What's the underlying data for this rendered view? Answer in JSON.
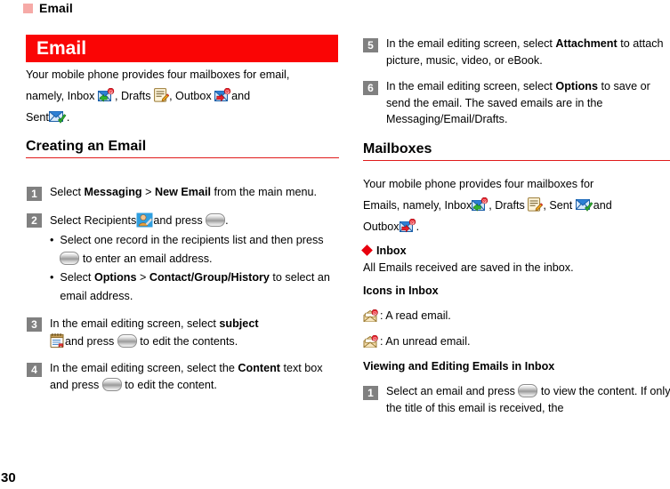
{
  "running_header": {
    "title": "Email",
    "marker_color": "#f6aaa7"
  },
  "title_bar": {
    "label": "Email",
    "bg": "#fa0505",
    "fg": "#ffffff"
  },
  "page_number": "30",
  "colors": {
    "accent_red": "#e01b1b",
    "title_red": "#fa0505",
    "diamond_red": "#e8000d",
    "step_badge": "#808080"
  },
  "left_column": {
    "intro": {
      "part1": "Your mobile phone provides four mailboxes for email,",
      "part2": "namely, Inbox",
      "part3": ", Drafts",
      "part4": ", Outbox",
      "part5": "and",
      "part6": "Sent",
      "part7": "."
    },
    "heading": "Creating an Email",
    "steps": [
      {
        "num": "1",
        "pre": "Select ",
        "b1": "Messaging",
        "mid": " > ",
        "b2": "New Email",
        "post": " from the main menu."
      },
      {
        "num": "2",
        "pre": "Select Recipients",
        "post": "and press ",
        "end": ".",
        "bullets": [
          {
            "pre": "Select one record in the recipients list and then press ",
            "post": " to enter an email address."
          },
          {
            "pre": "Select ",
            "b1": "Options",
            "mid": " > ",
            "b2": "Contact/Group/History",
            "post": " to select an email address."
          }
        ]
      },
      {
        "num": "3",
        "pre": "In the email editing screen, select ",
        "b1": "subject",
        "mid": "and press ",
        "post": " to edit the contents."
      },
      {
        "num": "4",
        "pre": "In the email editing screen, select the ",
        "b1": "Content",
        "mid": " text box and press ",
        "post": " to edit the content."
      }
    ]
  },
  "right_column": {
    "steps_top": [
      {
        "num": "5",
        "pre": "In the email editing screen, select ",
        "b1": "Attachment",
        "post": " to attach picture, music, video, or eBook."
      },
      {
        "num": "6",
        "pre": "In the email editing screen, select ",
        "b1": "Options",
        "post": " to save or send the email. The saved emails are in the Messaging/Email/Drafts."
      }
    ],
    "heading": "Mailboxes",
    "intro": {
      "part1": "Your mobile phone provides four mailboxes for",
      "part2": "Emails, namely, Inbox",
      "part3": ", Drafts",
      "part4": ",  Sent",
      "part5": "and",
      "part6": "Outbox",
      "part7": "."
    },
    "inbox_heading": "Inbox",
    "inbox_desc": "All Emails received are saved in the inbox.",
    "icons_heading": "Icons in Inbox",
    "icon_items": [
      {
        "label": ": A read email."
      },
      {
        "label": ": An unread email."
      }
    ],
    "viewing_heading": "Viewing and Editing Emails in Inbox",
    "steps_bottom": [
      {
        "num": "1",
        "pre": "Select an email and press ",
        "post": " to view the content. If only the title of this email is received, the"
      }
    ]
  },
  "icon_names": {
    "inbox": "inbox-mail-icon",
    "drafts": "drafts-note-icon",
    "outbox": "outbox-mail-icon",
    "sent": "sent-envelope-check-icon",
    "recipients": "contacts-person-icon",
    "subject": "notepad-icon",
    "ok_key": "ok-key-icon",
    "read": "read-email-icon",
    "unread": "unread-email-icon"
  }
}
